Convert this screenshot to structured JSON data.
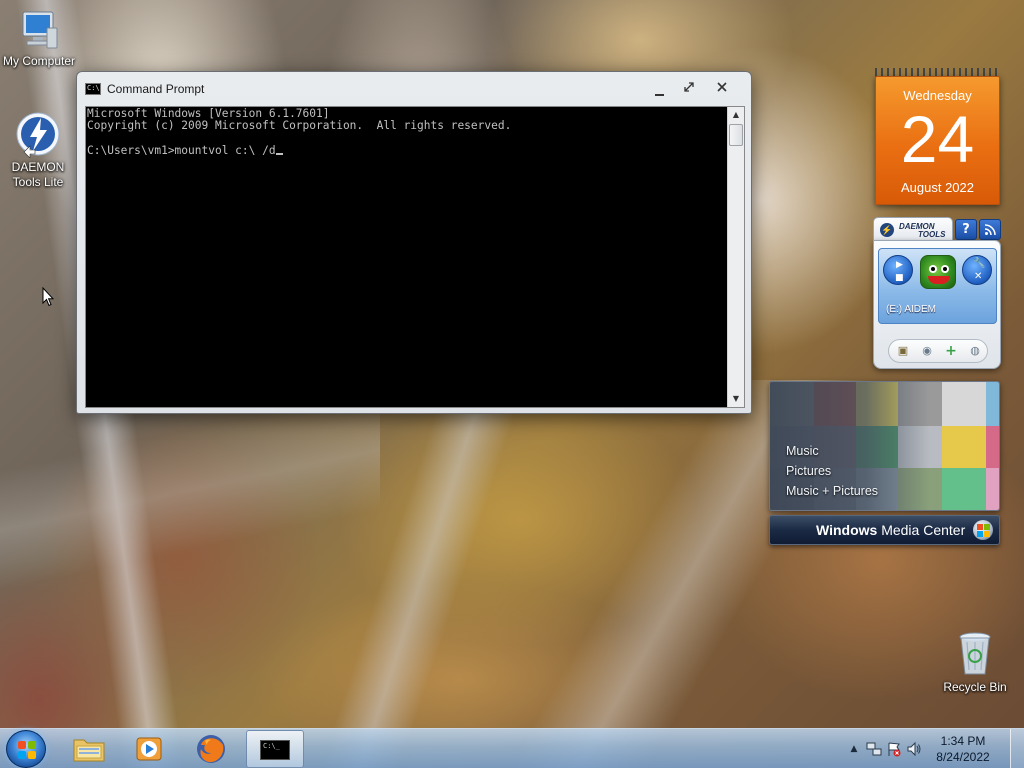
{
  "desktop": {
    "icons": [
      {
        "label": "My Computer",
        "icon": "computer-icon"
      },
      {
        "label": "DAEMON Tools Lite",
        "icon": "daemon-tools-icon"
      },
      {
        "label": "Recycle Bin",
        "icon": "recycle-bin-icon"
      }
    ]
  },
  "cmd_window": {
    "title": "Command Prompt",
    "icon": "cmd-icon",
    "controls": {
      "minimize": "minimize-icon",
      "maximize": "maximize-icon",
      "close": "close-icon"
    },
    "lines": [
      "Microsoft Windows [Version 6.1.7601]",
      "Copyright (c) 2009 Microsoft Corporation.  All rights reserved.",
      "",
      "C:\\Users\\vm1>mountvol c:\\ /d"
    ]
  },
  "calendar_gadget": {
    "weekday": "Wednesday",
    "day": "24",
    "month_year": "August 2022"
  },
  "daemon_gadget": {
    "logo_line1": "DAEMON",
    "logo_line2": "TOOLS",
    "help_label": "?",
    "drive_label": "(E:) AIDEM"
  },
  "media_center_gadget": {
    "items": [
      "Music",
      "Pictures",
      "Music + Pictures"
    ],
    "bar_bold": "Windows",
    "bar_rest": " Media Center"
  },
  "taskbar": {
    "pinned": [
      {
        "name": "explorer",
        "icon": "folder-icon"
      },
      {
        "name": "media-player",
        "icon": "media-player-icon"
      },
      {
        "name": "firefox",
        "icon": "firefox-icon"
      },
      {
        "name": "command-prompt",
        "icon": "cmd-icon",
        "active": true
      }
    ],
    "tray_icons": [
      "show-hidden-icon",
      "network-icon",
      "action-center-icon",
      "volume-icon"
    ],
    "time": "1:34 PM",
    "date": "8/24/2022"
  },
  "colors": {
    "calendar_orange": "#ea6f12",
    "console_bg": "#000000",
    "console_fg": "#c0c0c0",
    "taskbar": "#96b9dc"
  }
}
